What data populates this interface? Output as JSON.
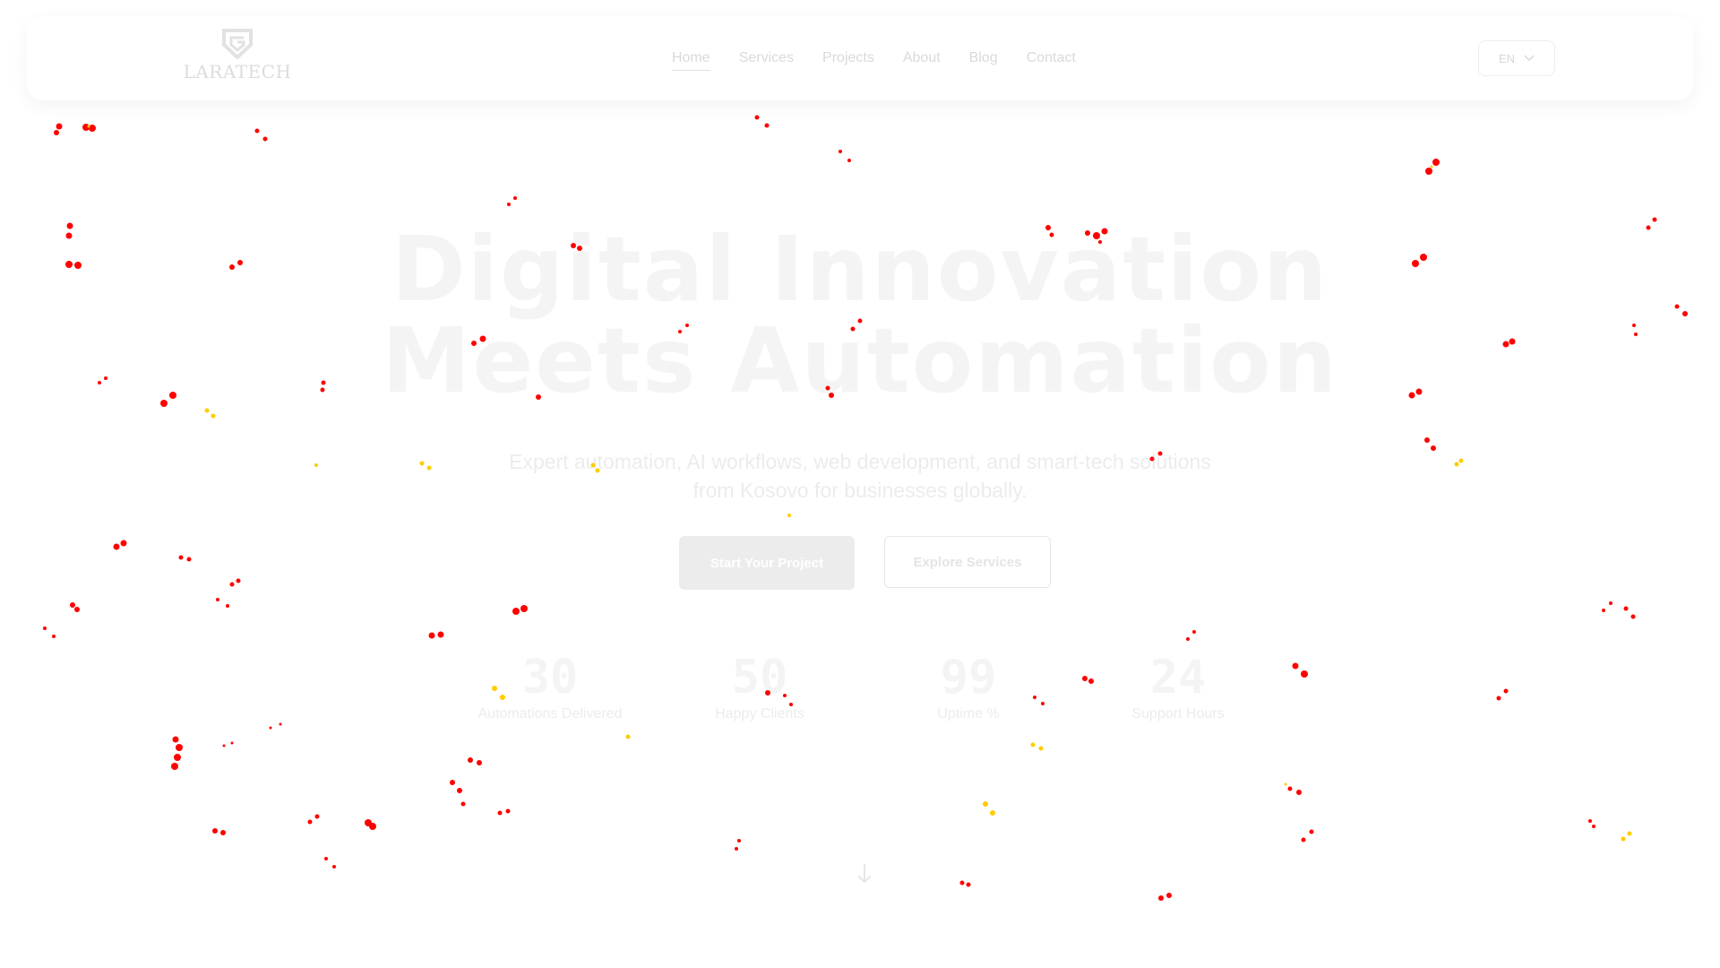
{
  "brand": {
    "logo_text": "LARATECH",
    "logo_icon": "shield-g-icon"
  },
  "nav": {
    "items": [
      {
        "label": "Home",
        "active": true
      },
      {
        "label": "Services"
      },
      {
        "label": "Projects"
      },
      {
        "label": "About"
      },
      {
        "label": "Blog"
      },
      {
        "label": "Contact"
      }
    ],
    "language": "EN"
  },
  "hero": {
    "title_line1": "Digital Innovation",
    "title_line2": "Meets Automation",
    "subtitle": "Expert automation, AI workflows, web development, and smart-tech solutions from Kosovo for businesses globally.",
    "primary_button": "Start Your Project",
    "secondary_button": "Explore Services"
  },
  "stats": [
    {
      "value": "30",
      "label": "Automations Delivered"
    },
    {
      "value": "50",
      "label": "Happy Clients"
    },
    {
      "value": "99",
      "label": "Uptime %"
    },
    {
      "value": "24",
      "label": "Support Hours"
    }
  ],
  "colors": {
    "particle_red": "#ff0000",
    "particle_yellow": "#ffcc00",
    "faded_text": "#eeeeee"
  },
  "icons": {
    "language_toggle": "chevron-down-icon",
    "scroll": "arrow-down-icon"
  }
}
